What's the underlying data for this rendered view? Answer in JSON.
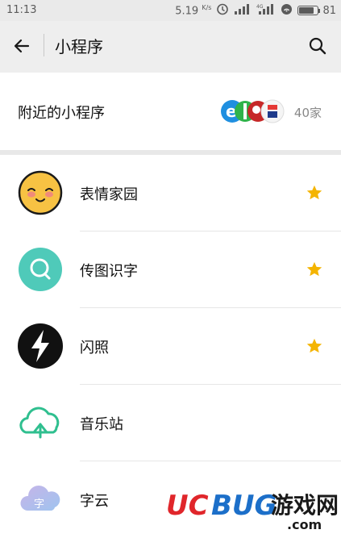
{
  "status": {
    "time": "11:13",
    "net_speed": "5.19",
    "net_speed_unit": "K/s",
    "battery": "81",
    "battery_level": 0.81
  },
  "nav": {
    "title": "小程序",
    "back_icon": "arrow-left-icon",
    "search_icon": "search-icon"
  },
  "nearby": {
    "label": "附近的小程序",
    "count": "40家"
  },
  "apps": [
    {
      "name": "表情家园",
      "icon": "smiley-face-icon",
      "starred": true
    },
    {
      "name": "传图识字",
      "icon": "magnifier-circle-icon",
      "starred": true
    },
    {
      "name": "闪照",
      "icon": "lightning-icon",
      "starred": true
    },
    {
      "name": "音乐站",
      "icon": "music-cloud-icon",
      "starred": false
    },
    {
      "name": "字云",
      "icon": "word-cloud-icon",
      "starred": false
    }
  ],
  "colors": {
    "star": "#f4b400",
    "smiley_face": "#f7c243",
    "magnifier_bg": "#4fcab9",
    "music_green": "#2fbf8f",
    "watermark_red": "#e0262b",
    "watermark_blue": "#1c6fc9"
  },
  "watermark": {
    "brand_a": "UC",
    "brand_b": "BUG",
    "cn_text": "游戏网",
    "domain": ".com"
  }
}
